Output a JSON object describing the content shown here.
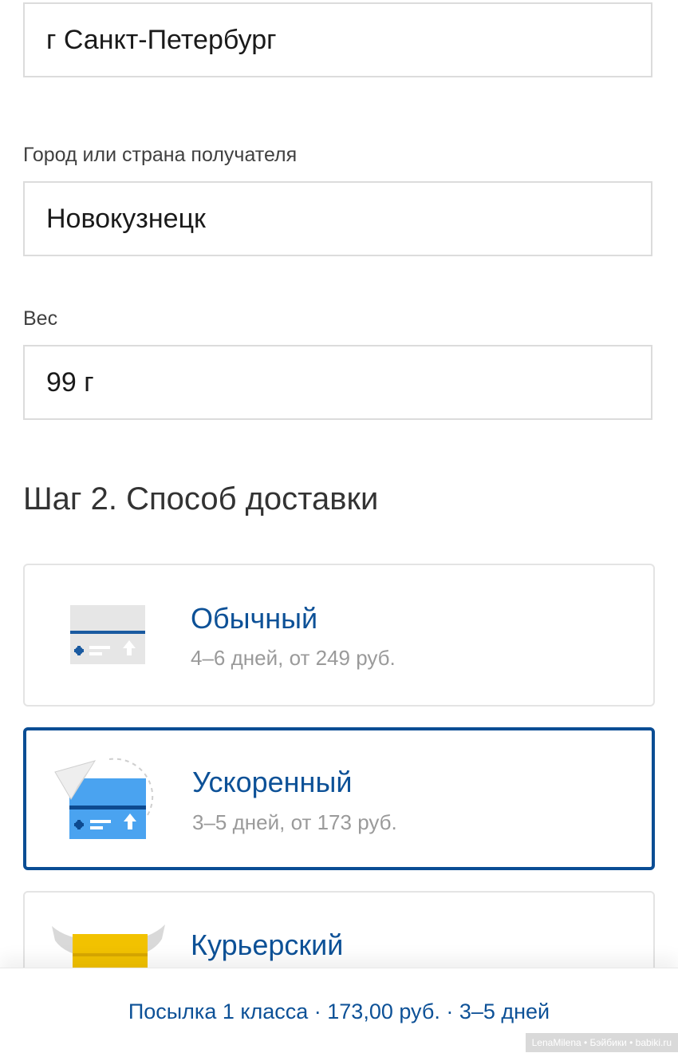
{
  "form": {
    "sender_city_value": "г Санкт-Петербург",
    "recipient_label": "Город или страна получателя",
    "recipient_value": "Новокузнецк",
    "weight_label": "Вес",
    "weight_value": "99 г"
  },
  "step2": {
    "title": "Шаг 2. Способ доставки",
    "options": [
      {
        "title": "Обычный",
        "subtitle": "4–6 дней, от 249 руб.",
        "icon": "envelope-regular-icon"
      },
      {
        "title": "Ускоренный",
        "subtitle": "3–5 дней, от 173 руб.",
        "icon": "envelope-express-icon",
        "selected": true
      },
      {
        "title": "Курьерский",
        "subtitle": "",
        "icon": "envelope-courier-icon"
      }
    ]
  },
  "summary": {
    "text": "Посылка 1 класса · 173,00 руб. · 3–5 дней"
  },
  "watermark": "LenaMilena • Бэйбики • babiki.ru",
  "colors": {
    "brand_blue": "#0d5197",
    "selected_border": "#0a4d94",
    "express_blue": "#4aa3f0",
    "courier_yellow": "#f2c200"
  }
}
